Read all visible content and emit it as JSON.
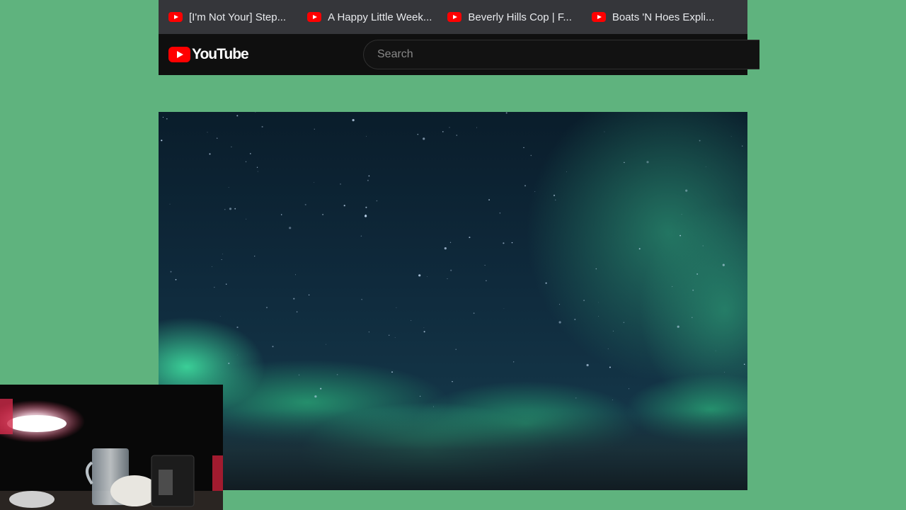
{
  "bookmarks": [
    {
      "label": "[I'm Not Your] Step...",
      "icon": "youtube-favicon"
    },
    {
      "label": "A Happy Little Week...",
      "icon": "youtube-favicon"
    },
    {
      "label": "Beverly Hills Cop | F...",
      "icon": "youtube-favicon"
    },
    {
      "label": "Boats 'N Hoes Expli...",
      "icon": "youtube-favicon"
    }
  ],
  "masthead": {
    "logo_text": "YouTube",
    "search_placeholder": "Search"
  },
  "colors": {
    "page_background": "#5fb37e",
    "bookmarks_bar": "#35363a",
    "masthead": "#0f0f0f",
    "youtube_red": "#ff0000",
    "aurora_green": "#2fd88a"
  },
  "video": {
    "content": "aurora-night-sky"
  },
  "webcam": {
    "content": "webcam-feed"
  }
}
